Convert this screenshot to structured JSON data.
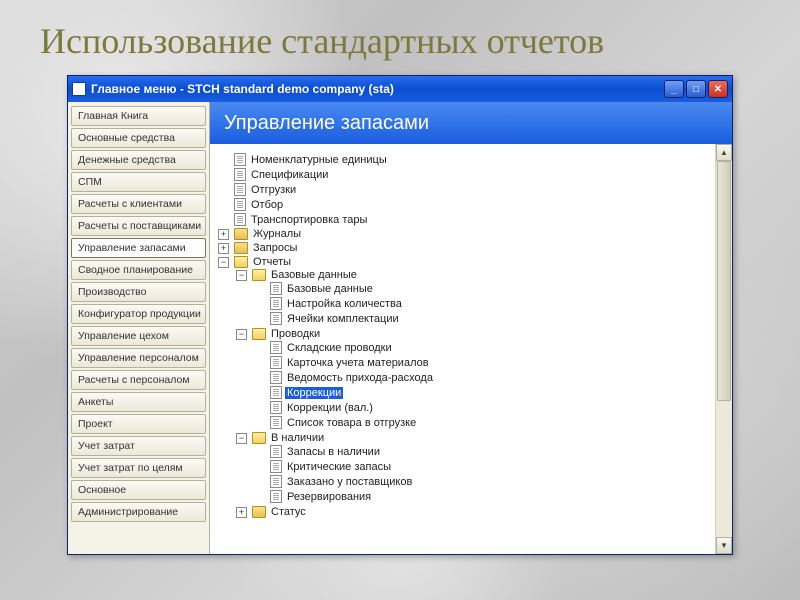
{
  "slide_title": "Использование стандартных отчетов",
  "window": {
    "title": "Главное меню  -  STCH standard demo company (sta)"
  },
  "sidebar": {
    "items": [
      "Главная Книга",
      "Основные средства",
      "Денежные средства",
      "СПМ",
      "Расчеты с клиентами",
      "Расчеты с поставщиками",
      "Управление запасами",
      "Сводное планирование",
      "Производство",
      "Конфигуратор продукции",
      "Управление цехом",
      "Управление персоналом",
      "Расчеты с персоналом",
      "Анкеты",
      "Проект",
      "Учет затрат",
      "Учет затрат по целям",
      "Основное",
      "Администрирование"
    ],
    "active_index": 6
  },
  "content": {
    "header": "Управление запасами"
  },
  "tree": {
    "top": [
      "Номенклатурные единицы",
      "Спецификации",
      "Отгрузки",
      "Отбор",
      "Транспортировка тары"
    ],
    "journals": "Журналы",
    "queries": "Запросы",
    "reports": {
      "label": "Отчеты",
      "base": {
        "label": "Базовые данные",
        "items": [
          "Базовые данные",
          "Настройка количества",
          "Ячейки комплектации"
        ]
      },
      "postings": {
        "label": "Проводки",
        "items": [
          "Складские проводки",
          "Карточка учета материалов",
          "Ведомость прихода-расхода",
          "Коррекции",
          "Коррекции (вал.)",
          "Список товара в отгрузке"
        ],
        "selected_index": 3
      },
      "onhand": {
        "label": "В наличии",
        "items": [
          "Запасы в наличии",
          "Критические запасы",
          "Заказано у поставщиков",
          "Резервирования"
        ]
      },
      "status": "Статус"
    }
  },
  "expanders": {
    "plus": "+",
    "minus": "−"
  }
}
